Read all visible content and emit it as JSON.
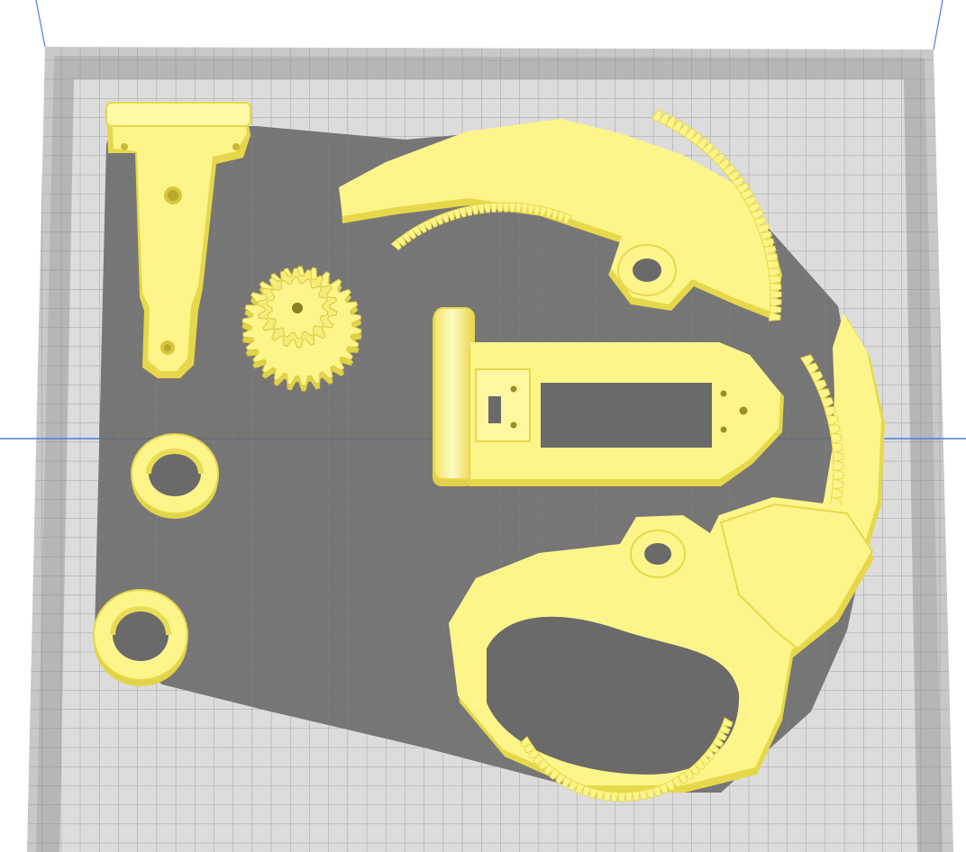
{
  "scene": {
    "background_color": "#ffffff",
    "bed_outer_color": "#c8c8c8",
    "bed_border_color": "#b2b2b2",
    "bed_inner_color": "#dcdcdc",
    "grid_line_color": "#8c8c8c",
    "axis_line_color": "#4a7fe0",
    "shadow_color": "#6a6a6a",
    "part_color": "#fdf58a",
    "part_edge_color": "#e6d84a",
    "part_side_color": "#e9dc55"
  },
  "parts": [
    {
      "id": "servo-horn-arm",
      "icon": "arm-bracket-icon"
    },
    {
      "id": "compound-spur-gear",
      "icon": "gear-icon"
    },
    {
      "id": "washer-ring-upper",
      "icon": "ring-icon"
    },
    {
      "id": "washer-ring-lower",
      "icon": "ring-icon"
    },
    {
      "id": "gripper-claw-upper",
      "icon": "claw-icon"
    },
    {
      "id": "servo-mount-frame",
      "icon": "frame-icon"
    },
    {
      "id": "gripper-claw-lower",
      "icon": "claw-icon"
    },
    {
      "id": "gripper-jaw-right",
      "icon": "jaw-icon"
    }
  ]
}
